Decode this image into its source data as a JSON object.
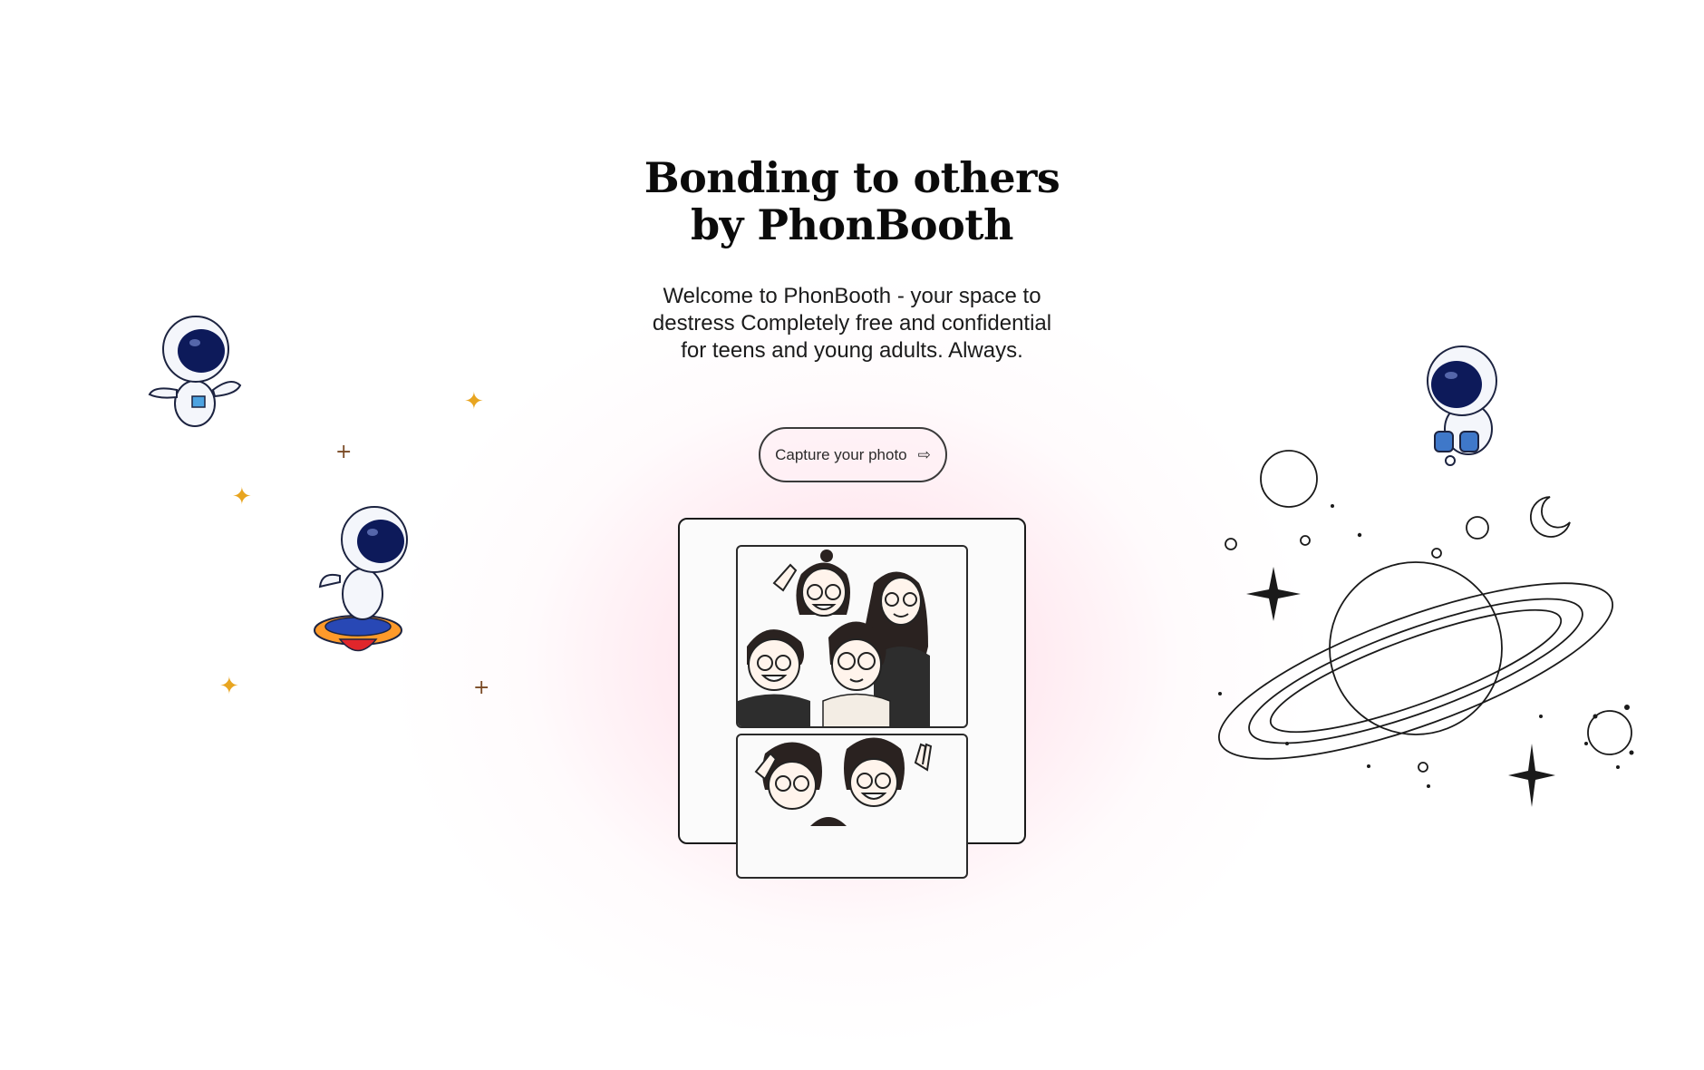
{
  "hero": {
    "title_line1": "Bonding to others",
    "title_line2": "by PhonBooth",
    "description": "Welcome to PhonBooth - your space to destress Completely free and confidential for teens and young adults. Always."
  },
  "cta": {
    "label": "Capture your photo",
    "icon": "arrow-right-icon"
  },
  "photo_strip": {
    "frames": [
      "group-photo-1",
      "group-photo-2"
    ]
  },
  "decorations": {
    "astronaut_icons": [
      "astronaut-floating-icon",
      "astronaut-surfboard-icon",
      "astronaut-binoculars-icon"
    ],
    "sparkle_color": "#f5c542",
    "glow_color": "#ff9ab5"
  }
}
